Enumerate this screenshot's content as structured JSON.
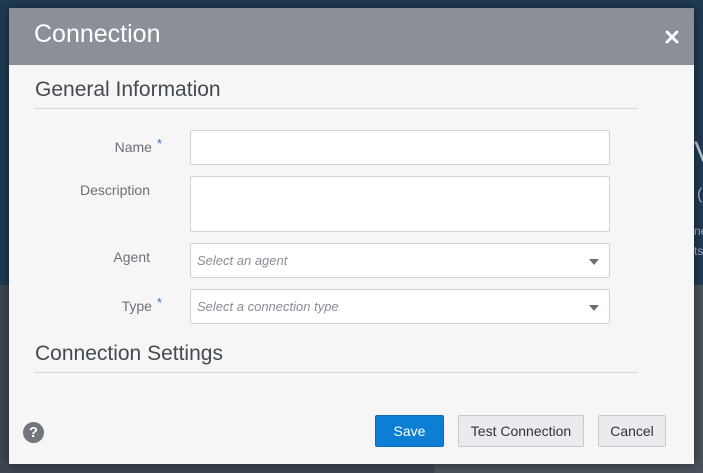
{
  "background": {
    "fragments": [
      "V",
      "(",
      "ne",
      "ts"
    ]
  },
  "dialog": {
    "title": "Connection",
    "close_icon": "close-icon",
    "general_section": {
      "title": "General Information",
      "fields": {
        "name": {
          "label": "Name",
          "required_mark": "*",
          "value": ""
        },
        "description": {
          "label": "Description",
          "value": ""
        },
        "agent": {
          "label": "Agent",
          "placeholder": "Select an agent"
        },
        "type": {
          "label": "Type",
          "required_mark": "*",
          "placeholder": "Select a connection type"
        }
      }
    },
    "settings_section": {
      "title": "Connection Settings"
    },
    "footer": {
      "help_icon": "help-icon",
      "help_glyph": "?",
      "save_label": "Save",
      "test_label": "Test Connection",
      "cancel_label": "Cancel"
    }
  },
  "colors": {
    "header_bg": "#8b9098",
    "primary_button": "#0c7ed3",
    "required_mark": "#2f77c8"
  }
}
